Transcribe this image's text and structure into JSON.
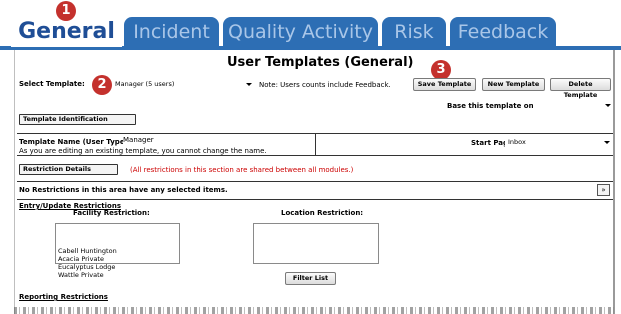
{
  "tabs": [
    {
      "label": "General",
      "active": true
    },
    {
      "label": "Incident",
      "active": false
    },
    {
      "label": "Quality Activity",
      "active": false
    },
    {
      "label": "Risk",
      "active": false
    },
    {
      "label": "Feedback",
      "active": false
    }
  ],
  "callouts": [
    "1",
    "2",
    "3"
  ],
  "colors": {
    "tab_active_text": "#1f4e96",
    "tab_bg": "#2d6eb4",
    "tab_inactive_text": "#a9c6e8",
    "callout": "#c4312d",
    "warning_text": "#cc0000"
  },
  "page": {
    "title": "User Templates (General)"
  },
  "template_select": {
    "label": "Select Template:",
    "value": "Manager (5 users)",
    "note": "Note: Users counts include Feedback."
  },
  "toolbar": {
    "save_label": "Save Template",
    "new_label": "New Template",
    "delete_label": "Delete Template"
  },
  "base_on": {
    "label": "Base this template on:",
    "value": ""
  },
  "identification": {
    "header": "Template Identification",
    "name_label": "Template Name (User Type):",
    "name_value": "Manager",
    "edit_note": "As you are editing an existing template, you cannot change the name.",
    "start_page_label": "Start Page:",
    "start_page_value": "Inbox"
  },
  "restrictions": {
    "header": "Restriction Details",
    "warning": "(All restrictions in this section are shared between all modules.)",
    "summary": "No Restrictions in this area have any selected items.",
    "collapse_icon": "double-chevron-up-icon",
    "entry_update_title": "Entry/Update Restrictions",
    "facility_title": "Facility Restriction:",
    "facility_items": [
      "Cabell Huntington",
      "Acacia Private",
      "Eucalyptus Lodge",
      "Wattle Private"
    ],
    "location_title": "Location Restriction:",
    "filter_label": "Filter List",
    "reporting_title": "Reporting Restrictions"
  }
}
